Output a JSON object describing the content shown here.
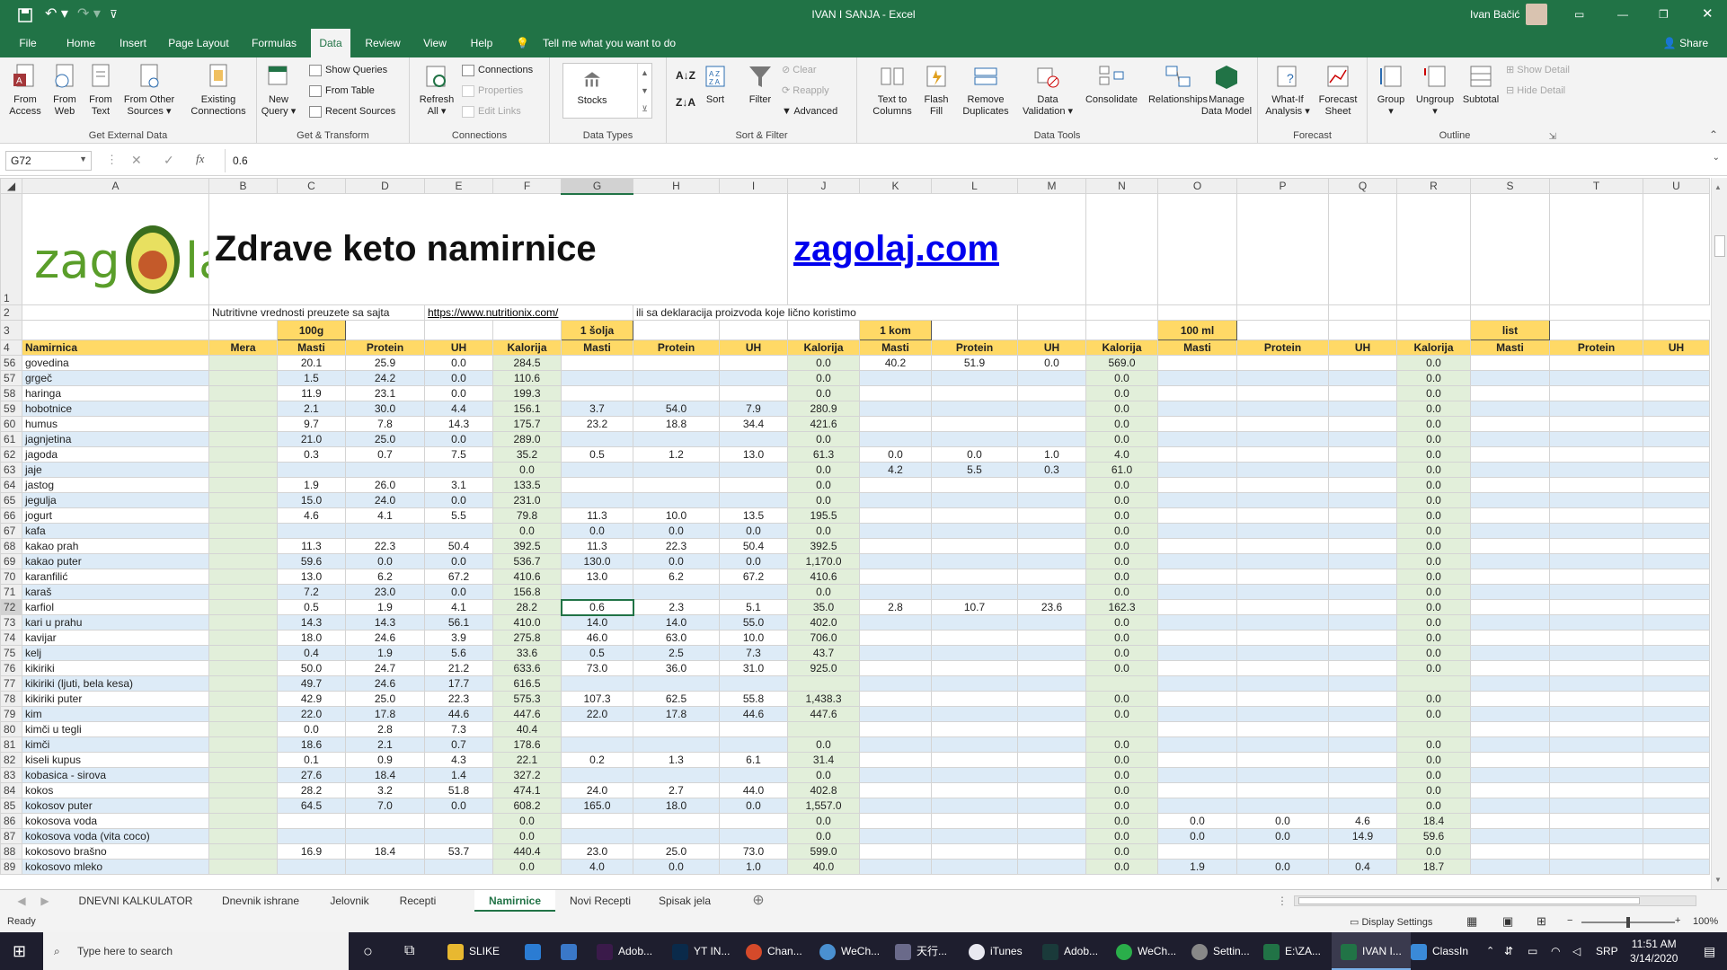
{
  "titlebar": {
    "title": "IVAN I SANJA  -  Excel",
    "user": "Ivan Bačić",
    "save_icon": "save-icon",
    "undo_icon": "undo-icon",
    "redo_icon": "redo-icon"
  },
  "ribbon_tabs": [
    "File",
    "Home",
    "Insert",
    "Page Layout",
    "Formulas",
    "Data",
    "Review",
    "View",
    "Help"
  ],
  "active_tab": "Data",
  "tell_me": "Tell me what you want to do",
  "share": "Share",
  "groups": {
    "get_external": {
      "name": "Get External Data",
      "buttons": [
        "From\nAccess",
        "From\nWeb",
        "From\nText",
        "From Other\nSources ▾",
        "Existing\nConnections"
      ]
    },
    "get_transform": {
      "name": "Get & Transform",
      "new_query": "New\nQuery ▾",
      "show_queries": "Show Queries",
      "from_table": "From Table",
      "recent_sources": "Recent Sources"
    },
    "connections": {
      "name": "Connections",
      "refresh": "Refresh\nAll ▾",
      "connections": "Connections",
      "properties": "Properties",
      "edit_links": "Edit Links"
    },
    "data_types": {
      "name": "Data Types",
      "stocks": "Stocks"
    },
    "sort_filter": {
      "name": "Sort & Filter",
      "sort": "Sort",
      "filter": "Filter",
      "clear": "Clear",
      "reapply": "Reapply",
      "advanced": "Advanced"
    },
    "data_tools": {
      "name": "Data Tools",
      "buttons": [
        "Text to\nColumns",
        "Flash\nFill",
        "Remove\nDuplicates",
        "Data\nValidation ▾",
        "Consolidate",
        "Relationships",
        "Manage\nData Model"
      ]
    },
    "forecast": {
      "name": "Forecast",
      "buttons": [
        "What-If\nAnalysis ▾",
        "Forecast\nSheet"
      ]
    },
    "outline": {
      "name": "Outline",
      "buttons": [
        "Group\n▾",
        "Ungroup\n▾",
        "Subtotal"
      ],
      "show_detail": "Show Detail",
      "hide_detail": "Hide Detail"
    }
  },
  "formula_bar": {
    "name_box": "G72",
    "formula": "0.6"
  },
  "columns": [
    "A",
    "B",
    "C",
    "D",
    "E",
    "F",
    "G",
    "H",
    "I",
    "J",
    "K",
    "L",
    "M",
    "N",
    "O",
    "P",
    "Q",
    "R",
    "S",
    "T",
    "U"
  ],
  "header": {
    "logo_text_left": "zag",
    "logo_text_right": "laj",
    "heading": "Zdrave keto namirnice",
    "site": "zagolaj.com",
    "row2_note": "Nutritivne vrednosti preuzete sa sajta",
    "row2_link": "https://www.nutritionix.com/",
    "row2_note2": "ili sa deklaracija proizvoda koje lično koristimo",
    "r3_100g": "100g",
    "r3_solja": "1 šolja",
    "r3_kom": "1 kom",
    "r3_100ml": "100 ml",
    "r3_list": "list",
    "r4": [
      "Namirnica",
      "Mera",
      "Masti",
      "Protein",
      "UH",
      "Kalorija",
      "Masti",
      "Protein",
      "UH",
      "Kalorija",
      "Masti",
      "Protein",
      "UH",
      "Kalorija",
      "Masti",
      "Protein",
      "UH",
      "Kalorija",
      "Masti",
      "Protein",
      "UH"
    ]
  },
  "rows": [
    {
      "n": "56",
      "c": [
        "govedina",
        "",
        "20.1",
        "25.9",
        "0.0",
        "284.5",
        "",
        "",
        "",
        "0.0",
        "40.2",
        "51.9",
        "0.0",
        "569.0",
        "",
        "",
        "",
        "0.0",
        "",
        "",
        ""
      ]
    },
    {
      "n": "57",
      "c": [
        "grgeč",
        "",
        "1.5",
        "24.2",
        "0.0",
        "110.6",
        "",
        "",
        "",
        "0.0",
        "",
        "",
        "",
        "0.0",
        "",
        "",
        "",
        "0.0",
        "",
        "",
        ""
      ]
    },
    {
      "n": "58",
      "c": [
        "haringa",
        "",
        "11.9",
        "23.1",
        "0.0",
        "199.3",
        "",
        "",
        "",
        "0.0",
        "",
        "",
        "",
        "0.0",
        "",
        "",
        "",
        "0.0",
        "",
        "",
        ""
      ]
    },
    {
      "n": "59",
      "c": [
        "hobotnice",
        "",
        "2.1",
        "30.0",
        "4.4",
        "156.1",
        "3.7",
        "54.0",
        "7.9",
        "280.9",
        "",
        "",
        "",
        "0.0",
        "",
        "",
        "",
        "0.0",
        "",
        "",
        ""
      ]
    },
    {
      "n": "60",
      "c": [
        "humus",
        "",
        "9.7",
        "7.8",
        "14.3",
        "175.7",
        "23.2",
        "18.8",
        "34.4",
        "421.6",
        "",
        "",
        "",
        "0.0",
        "",
        "",
        "",
        "0.0",
        "",
        "",
        ""
      ]
    },
    {
      "n": "61",
      "c": [
        "jagnjetina",
        "",
        "21.0",
        "25.0",
        "0.0",
        "289.0",
        "",
        "",
        "",
        "0.0",
        "",
        "",
        "",
        "0.0",
        "",
        "",
        "",
        "0.0",
        "",
        "",
        ""
      ]
    },
    {
      "n": "62",
      "c": [
        "jagoda",
        "",
        "0.3",
        "0.7",
        "7.5",
        "35.2",
        "0.5",
        "1.2",
        "13.0",
        "61.3",
        "0.0",
        "0.0",
        "1.0",
        "4.0",
        "",
        "",
        "",
        "0.0",
        "",
        "",
        ""
      ]
    },
    {
      "n": "63",
      "c": [
        "jaje",
        "",
        "",
        "",
        "",
        "0.0",
        "",
        "",
        "",
        "0.0",
        "4.2",
        "5.5",
        "0.3",
        "61.0",
        "",
        "",
        "",
        "0.0",
        "",
        "",
        ""
      ]
    },
    {
      "n": "64",
      "c": [
        "jastog",
        "",
        "1.9",
        "26.0",
        "3.1",
        "133.5",
        "",
        "",
        "",
        "0.0",
        "",
        "",
        "",
        "0.0",
        "",
        "",
        "",
        "0.0",
        "",
        "",
        ""
      ]
    },
    {
      "n": "65",
      "c": [
        "jegulja",
        "",
        "15.0",
        "24.0",
        "0.0",
        "231.0",
        "",
        "",
        "",
        "0.0",
        "",
        "",
        "",
        "0.0",
        "",
        "",
        "",
        "0.0",
        "",
        "",
        ""
      ]
    },
    {
      "n": "66",
      "c": [
        "jogurt",
        "",
        "4.6",
        "4.1",
        "5.5",
        "79.8",
        "11.3",
        "10.0",
        "13.5",
        "195.5",
        "",
        "",
        "",
        "0.0",
        "",
        "",
        "",
        "0.0",
        "",
        "",
        ""
      ]
    },
    {
      "n": "67",
      "c": [
        "kafa",
        "",
        "",
        "",
        "",
        "0.0",
        "0.0",
        "0.0",
        "0.0",
        "0.0",
        "",
        "",
        "",
        "0.0",
        "",
        "",
        "",
        "0.0",
        "",
        "",
        ""
      ]
    },
    {
      "n": "68",
      "c": [
        "kakao prah",
        "",
        "11.3",
        "22.3",
        "50.4",
        "392.5",
        "11.3",
        "22.3",
        "50.4",
        "392.5",
        "",
        "",
        "",
        "0.0",
        "",
        "",
        "",
        "0.0",
        "",
        "",
        ""
      ]
    },
    {
      "n": "69",
      "c": [
        "kakao puter",
        "",
        "59.6",
        "0.0",
        "0.0",
        "536.7",
        "130.0",
        "0.0",
        "0.0",
        "1,170.0",
        "",
        "",
        "",
        "0.0",
        "",
        "",
        "",
        "0.0",
        "",
        "",
        ""
      ]
    },
    {
      "n": "70",
      "c": [
        "karanfilić",
        "",
        "13.0",
        "6.2",
        "67.2",
        "410.6",
        "13.0",
        "6.2",
        "67.2",
        "410.6",
        "",
        "",
        "",
        "0.0",
        "",
        "",
        "",
        "0.0",
        "",
        "",
        ""
      ]
    },
    {
      "n": "71",
      "c": [
        "karaš",
        "",
        "7.2",
        "23.0",
        "0.0",
        "156.8",
        "",
        "",
        "",
        "0.0",
        "",
        "",
        "",
        "0.0",
        "",
        "",
        "",
        "0.0",
        "",
        "",
        ""
      ]
    },
    {
      "n": "72",
      "c": [
        "karfiol",
        "",
        "0.5",
        "1.9",
        "4.1",
        "28.2",
        "0.6",
        "2.3",
        "5.1",
        "35.0",
        "2.8",
        "10.7",
        "23.6",
        "162.3",
        "",
        "",
        "",
        "0.0",
        "",
        "",
        ""
      ]
    },
    {
      "n": "73",
      "c": [
        "kari u prahu",
        "",
        "14.3",
        "14.3",
        "56.1",
        "410.0",
        "14.0",
        "14.0",
        "55.0",
        "402.0",
        "",
        "",
        "",
        "0.0",
        "",
        "",
        "",
        "0.0",
        "",
        "",
        ""
      ]
    },
    {
      "n": "74",
      "c": [
        "kavijar",
        "",
        "18.0",
        "24.6",
        "3.9",
        "275.8",
        "46.0",
        "63.0",
        "10.0",
        "706.0",
        "",
        "",
        "",
        "0.0",
        "",
        "",
        "",
        "0.0",
        "",
        "",
        ""
      ]
    },
    {
      "n": "75",
      "c": [
        "kelj",
        "",
        "0.4",
        "1.9",
        "5.6",
        "33.6",
        "0.5",
        "2.5",
        "7.3",
        "43.7",
        "",
        "",
        "",
        "0.0",
        "",
        "",
        "",
        "0.0",
        "",
        "",
        ""
      ]
    },
    {
      "n": "76",
      "c": [
        "kikiriki",
        "",
        "50.0",
        "24.7",
        "21.2",
        "633.6",
        "73.0",
        "36.0",
        "31.0",
        "925.0",
        "",
        "",
        "",
        "0.0",
        "",
        "",
        "",
        "0.0",
        "",
        "",
        ""
      ]
    },
    {
      "n": "77",
      "c": [
        "kikiriki (ljuti, bela kesa)",
        "",
        "49.7",
        "24.6",
        "17.7",
        "616.5",
        "",
        "",
        "",
        "",
        "",
        "",
        "",
        "",
        "",
        "",
        "",
        "",
        "",
        "",
        ""
      ]
    },
    {
      "n": "78",
      "c": [
        "kikiriki puter",
        "",
        "42.9",
        "25.0",
        "22.3",
        "575.3",
        "107.3",
        "62.5",
        "55.8",
        "1,438.3",
        "",
        "",
        "",
        "0.0",
        "",
        "",
        "",
        "0.0",
        "",
        "",
        ""
      ]
    },
    {
      "n": "79",
      "c": [
        "kim",
        "",
        "22.0",
        "17.8",
        "44.6",
        "447.6",
        "22.0",
        "17.8",
        "44.6",
        "447.6",
        "",
        "",
        "",
        "0.0",
        "",
        "",
        "",
        "0.0",
        "",
        "",
        ""
      ]
    },
    {
      "n": "80",
      "c": [
        "kimči u tegli",
        "",
        "0.0",
        "2.8",
        "7.3",
        "40.4",
        "",
        "",
        "",
        "",
        "",
        "",
        "",
        "",
        "",
        "",
        "",
        "",
        "",
        "",
        ""
      ]
    },
    {
      "n": "81",
      "c": [
        "kimči",
        "",
        "18.6",
        "2.1",
        "0.7",
        "178.6",
        "",
        "",
        "",
        "0.0",
        "",
        "",
        "",
        "0.0",
        "",
        "",
        "",
        "0.0",
        "",
        "",
        ""
      ]
    },
    {
      "n": "82",
      "c": [
        "kiseli kupus",
        "",
        "0.1",
        "0.9",
        "4.3",
        "22.1",
        "0.2",
        "1.3",
        "6.1",
        "31.4",
        "",
        "",
        "",
        "0.0",
        "",
        "",
        "",
        "0.0",
        "",
        "",
        ""
      ]
    },
    {
      "n": "83",
      "c": [
        "kobasica - sirova",
        "",
        "27.6",
        "18.4",
        "1.4",
        "327.2",
        "",
        "",
        "",
        "0.0",
        "",
        "",
        "",
        "0.0",
        "",
        "",
        "",
        "0.0",
        "",
        "",
        ""
      ]
    },
    {
      "n": "84",
      "c": [
        "kokos",
        "",
        "28.2",
        "3.2",
        "51.8",
        "474.1",
        "24.0",
        "2.7",
        "44.0",
        "402.8",
        "",
        "",
        "",
        "0.0",
        "",
        "",
        "",
        "0.0",
        "",
        "",
        ""
      ]
    },
    {
      "n": "85",
      "c": [
        "kokosov puter",
        "",
        "64.5",
        "7.0",
        "0.0",
        "608.2",
        "165.0",
        "18.0",
        "0.0",
        "1,557.0",
        "",
        "",
        "",
        "0.0",
        "",
        "",
        "",
        "0.0",
        "",
        "",
        ""
      ]
    },
    {
      "n": "86",
      "c": [
        "kokosova voda",
        "",
        "",
        "",
        "",
        "0.0",
        "",
        "",
        "",
        "0.0",
        "",
        "",
        "",
        "0.0",
        "0.0",
        "0.0",
        "4.6",
        "18.4",
        "",
        "",
        ""
      ]
    },
    {
      "n": "87",
      "c": [
        "kokosova voda (vita coco)",
        "",
        "",
        "",
        "",
        "0.0",
        "",
        "",
        "",
        "0.0",
        "",
        "",
        "",
        "0.0",
        "0.0",
        "0.0",
        "14.9",
        "59.6",
        "",
        "",
        ""
      ]
    },
    {
      "n": "88",
      "c": [
        "kokosovo brašno",
        "",
        "16.9",
        "18.4",
        "53.7",
        "440.4",
        "23.0",
        "25.0",
        "73.0",
        "599.0",
        "",
        "",
        "",
        "0.0",
        "",
        "",
        "",
        "0.0",
        "",
        "",
        ""
      ]
    },
    {
      "n": "89",
      "c": [
        "kokosovo mleko",
        "",
        "",
        "",
        "",
        "0.0",
        "4.0",
        "0.0",
        "1.0",
        "40.0",
        "",
        "",
        "",
        "0.0",
        "1.9",
        "0.0",
        "0.4",
        "18.7",
        "",
        "",
        ""
      ]
    }
  ],
  "sheet_tabs": [
    "DNEVNI KALKULATOR",
    "Dnevnik ishrane",
    "Jelovnik",
    "Recepti",
    "Namirnice",
    "Novi Recepti",
    "Spisak jela"
  ],
  "active_sheet": "Namirnice",
  "status": {
    "ready": "Ready",
    "display_settings": "Display Settings",
    "zoom": "100%"
  },
  "taskbar": {
    "search": "Type here to search",
    "apps": [
      "SLIKE",
      "",
      "",
      "Adob...",
      "YT IN...",
      "Chan...",
      "WeCh...",
      "天行...",
      "iTunes",
      "Adob...",
      "WeCh...",
      "Settin...",
      "E:\\ZA...",
      "IVAN I...",
      "ClassIn"
    ],
    "lang": "SRP",
    "time": "11:51 AM",
    "date": "3/14/2020"
  }
}
